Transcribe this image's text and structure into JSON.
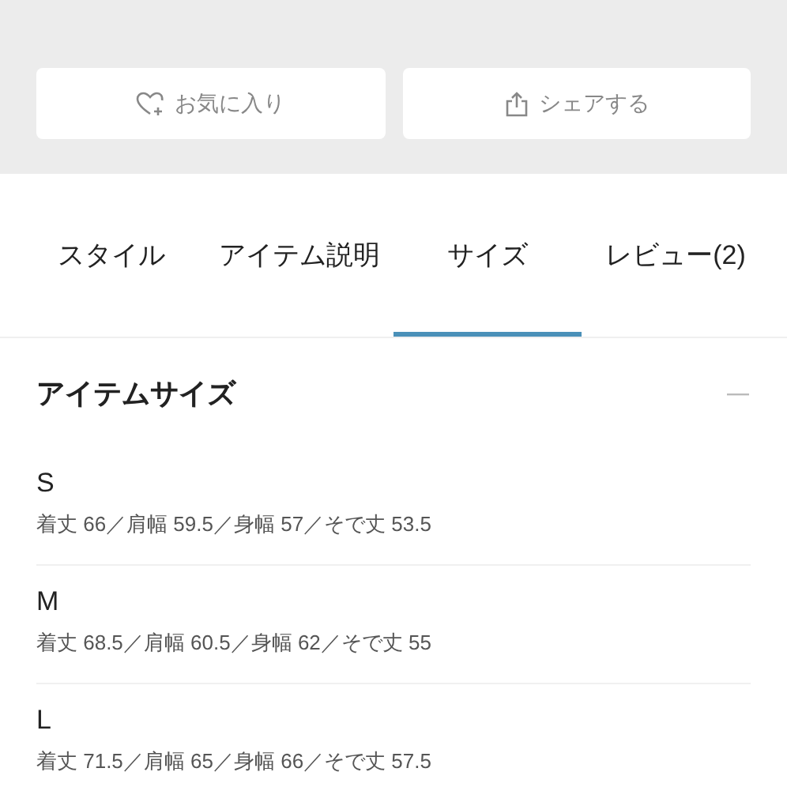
{
  "actions": [
    {
      "kind": "favorite",
      "label": "お気に入り"
    },
    {
      "kind": "share",
      "label": "シェアする"
    }
  ],
  "tabs": [
    {
      "label": "スタイル",
      "selected": false
    },
    {
      "label": "アイテム説明",
      "selected": false
    },
    {
      "label": "サイズ",
      "selected": true
    },
    {
      "label": "レビュー(2)",
      "selected": false
    }
  ],
  "section": {
    "title": "アイテムサイズ",
    "expanded": true,
    "sizes": [
      {
        "name": "S",
        "measurements": "着丈 66／肩幅 59.5／身幅 57／そで丈 53.5"
      },
      {
        "name": "M",
        "measurements": "着丈 68.5／肩幅 60.5／身幅 62／そで丈 55"
      },
      {
        "name": "L",
        "measurements": "着丈 71.5／肩幅 65／身幅 66／そで丈 57.5"
      }
    ]
  }
}
